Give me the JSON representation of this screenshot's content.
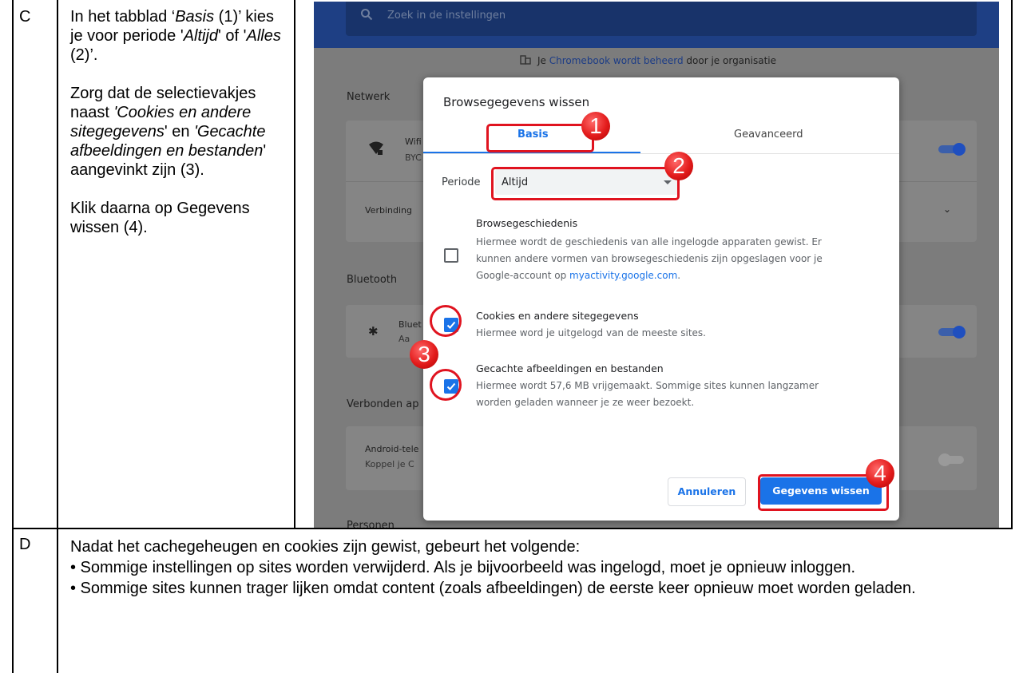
{
  "rows": {
    "c": {
      "letter": "C",
      "p1": [
        "In het tabblad ‘",
        "Basis",
        " (1)’ kies je voor periode '",
        "Altijd",
        "' of '",
        "Alles",
        " (2)’."
      ],
      "p2": [
        "Zorg dat de selectievakjes naast ",
        "'Cookies en andere sitegegevens",
        "' en ",
        "'Gecachte afbeeldingen en bestanden",
        "' aangevinkt zijn (3)."
      ],
      "p3": "Klik daarna op Gegevens wissen (4)."
    },
    "d": {
      "letter": "D",
      "lines": [
        "Nadat het cachegeheugen en cookies zijn gewist, gebeurt het volgende:",
        "• Sommige instellingen op sites worden verwijderd. Als je bijvoorbeeld was ingelogd, moet je opnieuw inloggen.",
        "• Sommige sites kunnen trager lijken omdat content (zoals afbeeldingen) de eerste keer opnieuw moet worden geladen."
      ]
    }
  },
  "screenshot": {
    "search_placeholder": "Zoek in de instellingen",
    "managed_prefix": "Je ",
    "managed_link": "Chromebook wordt beheerd",
    "managed_suffix": " door je organisatie",
    "sections": {
      "network": "Netwerk",
      "bluetooth": "Bluetooth",
      "connected": "Verbonden ap",
      "people": "Personen"
    },
    "network_card": {
      "title": "Wifi",
      "sub": "BYC",
      "connection": "Verbinding"
    },
    "bluetooth_card": {
      "title": "Bluet",
      "sub": "Aa"
    },
    "android_card": {
      "title": "Android-tele",
      "sub": "Koppel je C"
    },
    "dialog": {
      "title": "Browsegegevens wissen",
      "tabs": [
        "Basis",
        "Geavanceerd"
      ],
      "period_label": "Periode",
      "period_value": "Altijd",
      "items": [
        {
          "title": "Browsegeschiedenis",
          "desc": "Hiermee wordt de geschiedenis van alle ingelogde apparaten gewist. Er kunnen andere vormen van browsegeschiedenis zijn opgeslagen voor je Google-account op ",
          "desc_link": "myactivity.google.com",
          "desc_end": ".",
          "checked": false
        },
        {
          "title": "Cookies en andere sitegegevens",
          "desc": "Hiermee word je uitgelogd van de meeste sites.",
          "checked": true
        },
        {
          "title": "Gecachte afbeeldingen en bestanden",
          "desc": "Hiermee wordt 57,6 MB vrijgemaakt. Sommige sites kunnen langzamer worden geladen wanneer je ze weer bezoekt.",
          "checked": true
        }
      ],
      "cancel_label": "Annuleren",
      "clear_label": "Gegevens wissen"
    },
    "badges": [
      "1",
      "2",
      "3",
      "4"
    ]
  }
}
